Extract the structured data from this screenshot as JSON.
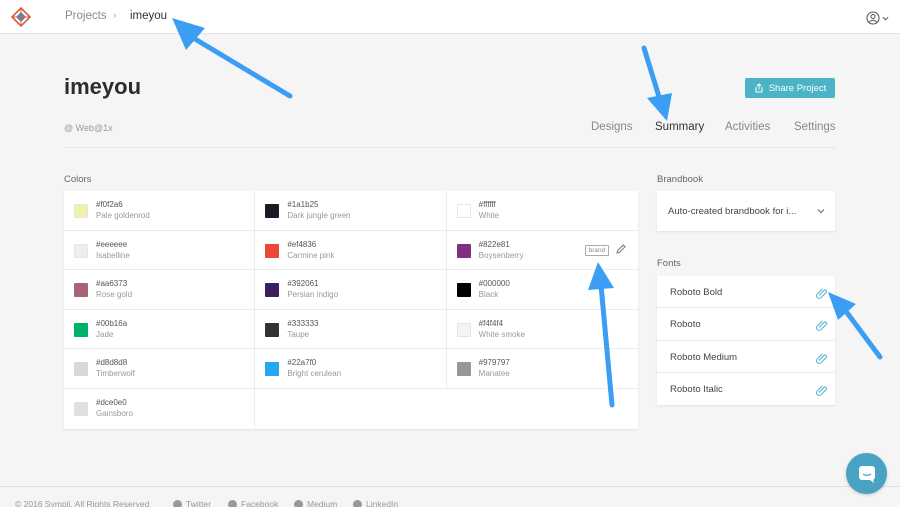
{
  "breadcrumb": {
    "projects": "Projects",
    "separator": "›",
    "current": "imeyou"
  },
  "project": {
    "title": "imeyou",
    "platform": "@ Web@1x",
    "share_label": "Share Project"
  },
  "tabs": [
    {
      "label": "Designs",
      "active": false
    },
    {
      "label": "Summary",
      "active": true
    },
    {
      "label": "Activities",
      "active": false
    },
    {
      "label": "Settings",
      "active": false
    }
  ],
  "colors": {
    "label": "Colors",
    "items": [
      {
        "hex": "#f0f2a6",
        "name": "Pale goldenrod"
      },
      {
        "hex": "#1a1b25",
        "name": "Dark jungle green"
      },
      {
        "hex": "#ffffff",
        "name": "White"
      },
      {
        "hex": "#eeeeee",
        "name": "Isabelline"
      },
      {
        "hex": "#ef4836",
        "name": "Carmine pink"
      },
      {
        "hex": "#822e81",
        "name": "Boysenberry",
        "tag": "brand"
      },
      {
        "hex": "#aa6373",
        "name": "Rose gold"
      },
      {
        "hex": "#392061",
        "name": "Persian indigo"
      },
      {
        "hex": "#000000",
        "name": "Black"
      },
      {
        "hex": "#00b16a",
        "name": "Jade"
      },
      {
        "hex": "#333333",
        "name": "Taupe"
      },
      {
        "hex": "#f4f4f4",
        "name": "White smoke"
      },
      {
        "hex": "#d8d8d8",
        "name": "Timberwolf"
      },
      {
        "hex": "#22a7f0",
        "name": "Bright cerulean"
      },
      {
        "hex": "#979797",
        "name": "Manatee"
      },
      {
        "hex": "#dce0e0",
        "name": "Gainsboro"
      }
    ]
  },
  "brandbook": {
    "label": "Brandbook",
    "value": "Auto-created brandbook for i..."
  },
  "fonts": {
    "label": "Fonts",
    "items": [
      "Roboto Bold",
      "Roboto",
      "Roboto Medium",
      "Roboto Italic"
    ]
  },
  "footer": {
    "copyright": "© 2016 Sympli. All Rights Reserved",
    "links": [
      "Twitter",
      "Facebook",
      "Medium",
      "LinkedIn"
    ]
  },
  "theme": {
    "accent": "#4ab3c6",
    "arrow": "#3b9ef2",
    "chat": "#4aa2c3"
  }
}
